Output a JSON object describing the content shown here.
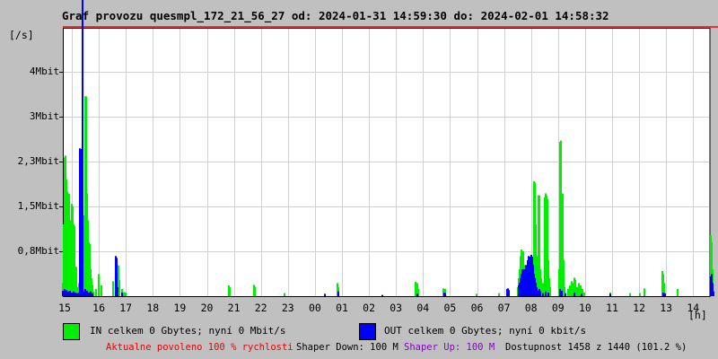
{
  "title": "Graf provozu quesmpl_172_21_56_27 od: 2024-01-31 14:59:30 do: 2024-02-01 14:58:32",
  "y_axis": {
    "unit": "[/s]",
    "ticks": [
      "4Mbit",
      "3Mbit",
      "2,3Mbit",
      "1,5Mbit",
      "0,8Mbit"
    ]
  },
  "x_axis": {
    "unit": "[h]",
    "hours": [
      "15",
      "16",
      "17",
      "18",
      "19",
      "20",
      "21",
      "22",
      "23",
      "00",
      "01",
      "02",
      "03",
      "04",
      "05",
      "06",
      "07",
      "08",
      "09",
      "10",
      "11",
      "12",
      "13",
      "14"
    ]
  },
  "legend": {
    "in_label": "IN celkem 0 Gbytes; nyní 0 Mbit/s",
    "out_label": "OUT celkem 0 Gbytes; nyní 0 kbit/s"
  },
  "status": {
    "allowed": "Aktualne povoleno 100 % rychlosti",
    "shaper_down": "Shaper Down: 100 M",
    "shaper_up": "Shaper Up: 100 M",
    "availability": "Dostupnost 1458 z 1440 (101.2 %)"
  },
  "colors": {
    "background": "#c0c0c0",
    "plot_background": "#ffffff",
    "grid": "#d0d0d0",
    "frame": "#000000",
    "top_line": "#ff0000",
    "in_series": "#00ee00",
    "out_series": "#0000ff",
    "alert_text": "#ee0000",
    "shaper_up_text": "#8800cc"
  },
  "chart_data": {
    "type": "area",
    "title": "Graf provozu quesmpl_172_21_56_27 od: 2024-01-31 14:59:30 do: 2024-02-01 14:58:32",
    "x_unit_label": "[h]",
    "y_unit_label": "[/s]",
    "y_tick_labels": [
      "4Mbit",
      "3Mbit",
      "2,3Mbit",
      "1,5Mbit",
      "0,8Mbit"
    ],
    "x_categories": [
      "15",
      "16",
      "17",
      "18",
      "19",
      "20",
      "21",
      "22",
      "23",
      "00",
      "01",
      "02",
      "03",
      "04",
      "05",
      "06",
      "07",
      "08",
      "09",
      "10",
      "11",
      "12",
      "13",
      "14"
    ],
    "ylim_mbit": [
      0,
      4.95
    ],
    "grid": true,
    "legend_position": "bottom",
    "series": [
      {
        "name": "IN",
        "color": "#00ee00",
        "points": [
          [
            70,
            0.22
          ],
          [
            71,
            1.2
          ],
          [
            72,
            2.32
          ],
          [
            73,
            2.35
          ],
          [
            74,
            1.95
          ],
          [
            75,
            1.75
          ],
          [
            76,
            1.71
          ],
          [
            77,
            1.71
          ],
          [
            78,
            1.05
          ],
          [
            79,
            1.27
          ],
          [
            80,
            1.54
          ],
          [
            81,
            1.5
          ],
          [
            82,
            1.2
          ],
          [
            83,
            1.17
          ],
          [
            84,
            0.49
          ],
          [
            85,
            0.49
          ],
          [
            86,
            0.15
          ],
          [
            87,
            0.05
          ],
          [
            88,
            0.22
          ],
          [
            93,
            0.3
          ],
          [
            94,
            1.35
          ],
          [
            95,
            3.34
          ],
          [
            96,
            3.34
          ],
          [
            97,
            1.72
          ],
          [
            98,
            1.27
          ],
          [
            99,
            0.9
          ],
          [
            100,
            0.87
          ],
          [
            101,
            0.45
          ],
          [
            102,
            0.3
          ],
          [
            103,
            0.19
          ],
          [
            104,
            0.08
          ],
          [
            107,
            0.12
          ],
          [
            110,
            0.37
          ],
          [
            113,
            0.18
          ],
          [
            126,
            0.25
          ],
          [
            131,
            0.52
          ],
          [
            132,
            0.51
          ],
          [
            133,
            0.27
          ],
          [
            136,
            0.12
          ],
          [
            138,
            0.07
          ],
          [
            140,
            0.06
          ],
          [
            255,
            0.18
          ],
          [
            256,
            0.15
          ],
          [
            283,
            0.19
          ],
          [
            284,
            0.16
          ],
          [
            317,
            0.05
          ],
          [
            376,
            0.22
          ],
          [
            377,
            0.15
          ],
          [
            463,
            0.24
          ],
          [
            465,
            0.22
          ],
          [
            466,
            0.12
          ],
          [
            494,
            0.13
          ],
          [
            496,
            0.12
          ],
          [
            531,
            0.04
          ],
          [
            556,
            0.05
          ],
          [
            577,
            0.15
          ],
          [
            578,
            0.3
          ],
          [
            579,
            0.45
          ],
          [
            580,
            0.67
          ],
          [
            581,
            0.78
          ],
          [
            582,
            0.72
          ],
          [
            583,
            0.75
          ],
          [
            584,
            0.52
          ],
          [
            585,
            0.45
          ],
          [
            586,
            0.4
          ],
          [
            587,
            0.37
          ],
          [
            588,
            0.4
          ],
          [
            589,
            0.3
          ],
          [
            590,
            0.22
          ],
          [
            592,
            0.27
          ],
          [
            594,
            0.18
          ],
          [
            595,
            1.92
          ],
          [
            596,
            1.9
          ],
          [
            597,
            1.2
          ],
          [
            598,
            0.67
          ],
          [
            599,
            0.45
          ],
          [
            600,
            1.69
          ],
          [
            601,
            1.68
          ],
          [
            602,
            0.45
          ],
          [
            603,
            0.3
          ],
          [
            605,
            0.22
          ],
          [
            607,
            1.65
          ],
          [
            608,
            1.72
          ],
          [
            609,
            1.68
          ],
          [
            610,
            1.62
          ],
          [
            611,
            0.6
          ],
          [
            612,
            0.3
          ],
          [
            613,
            0.15
          ],
          [
            623,
            0.45
          ],
          [
            624,
            2.58
          ],
          [
            625,
            2.6
          ],
          [
            626,
            1.72
          ],
          [
            627,
            1.71
          ],
          [
            628,
            0.6
          ],
          [
            629,
            0.15
          ],
          [
            633,
            0.12
          ],
          [
            635,
            0.18
          ],
          [
            637,
            0.25
          ],
          [
            638,
            0.22
          ],
          [
            639,
            0.12
          ],
          [
            640,
            0.31
          ],
          [
            641,
            0.27
          ],
          [
            643,
            0.15
          ],
          [
            645,
            0.22
          ],
          [
            647,
            0.18
          ],
          [
            649,
            0.12
          ],
          [
            651,
            0.06
          ],
          [
            680,
            0.06
          ],
          [
            702,
            0.05
          ],
          [
            713,
            0.05
          ],
          [
            718,
            0.13
          ],
          [
            738,
            0.42
          ],
          [
            739,
            0.37
          ],
          [
            740,
            0.22
          ],
          [
            755,
            0.12
          ],
          [
            792,
            1.02
          ],
          [
            793,
            0.9
          ],
          [
            794,
            0.45
          ]
        ]
      },
      {
        "name": "OUT",
        "color": "#0000ff",
        "points": [
          [
            70,
            0.09
          ],
          [
            72,
            0.12
          ],
          [
            74,
            0.1
          ],
          [
            76,
            0.08
          ],
          [
            78,
            0.09
          ],
          [
            80,
            0.06
          ],
          [
            82,
            0.08
          ],
          [
            84,
            0.06
          ],
          [
            86,
            0.05
          ],
          [
            88,
            0.06
          ],
          [
            89,
            2.47
          ],
          [
            90,
            2.46
          ],
          [
            92,
            4.95
          ],
          [
            93,
            0.08
          ],
          [
            95,
            0.12
          ],
          [
            97,
            0.09
          ],
          [
            99,
            0.06
          ],
          [
            101,
            0.08
          ],
          [
            103,
            0.05
          ],
          [
            129,
            0.67
          ],
          [
            130,
            0.64
          ],
          [
            131,
            0.15
          ],
          [
            136,
            0.06
          ],
          [
            362,
            0.04
          ],
          [
            377,
            0.08
          ],
          [
            426,
            0.02
          ],
          [
            465,
            0.04
          ],
          [
            495,
            0.06
          ],
          [
            496,
            0.05
          ],
          [
            565,
            0.12
          ],
          [
            566,
            0.13
          ],
          [
            567,
            0.1
          ],
          [
            578,
            0.18
          ],
          [
            579,
            0.22
          ],
          [
            580,
            0.3
          ],
          [
            581,
            0.37
          ],
          [
            582,
            0.45
          ],
          [
            583,
            0.4
          ],
          [
            584,
            0.45
          ],
          [
            585,
            0.37
          ],
          [
            586,
            0.52
          ],
          [
            587,
            0.45
          ],
          [
            588,
            0.6
          ],
          [
            589,
            0.67
          ],
          [
            590,
            0.66
          ],
          [
            591,
            0.63
          ],
          [
            592,
            0.69
          ],
          [
            593,
            0.66
          ],
          [
            594,
            0.52
          ],
          [
            595,
            0.37
          ],
          [
            596,
            0.3
          ],
          [
            597,
            0.22
          ],
          [
            598,
            0.15
          ],
          [
            599,
            0.09
          ],
          [
            600,
            0.06
          ],
          [
            601,
            0.12
          ],
          [
            602,
            0.08
          ],
          [
            605,
            0.05
          ],
          [
            608,
            0.08
          ],
          [
            611,
            0.06
          ],
          [
            624,
            0.12
          ],
          [
            626,
            0.09
          ],
          [
            630,
            0.05
          ],
          [
            640,
            0.06
          ],
          [
            648,
            0.04
          ],
          [
            680,
            0.04
          ],
          [
            739,
            0.06
          ],
          [
            741,
            0.05
          ],
          [
            792,
            0.33
          ],
          [
            793,
            0.37
          ],
          [
            794,
            0.22
          ],
          [
            795,
            0.08
          ]
        ]
      }
    ]
  }
}
